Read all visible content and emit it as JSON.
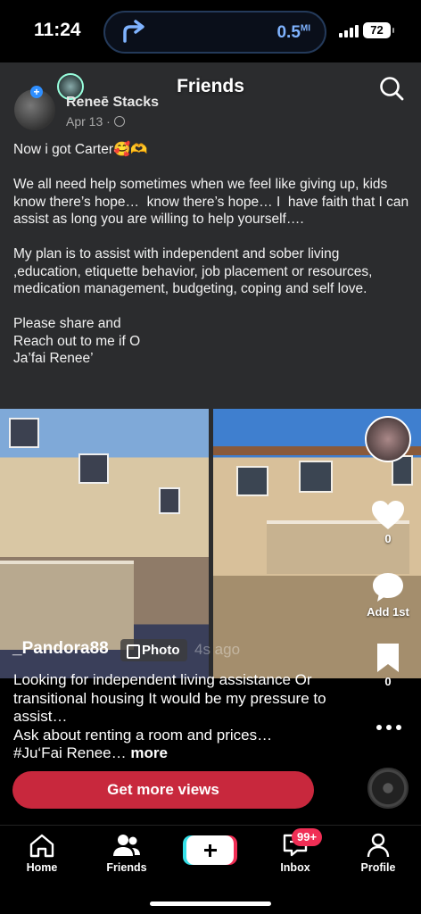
{
  "status_bar": {
    "time": "11:24",
    "navigation_distance": "0.5",
    "navigation_unit": "MI",
    "battery": "72"
  },
  "header": {
    "title": "Friends",
    "search_icon": "search-icon"
  },
  "post": {
    "author": "Reneē Stacks",
    "date": "Apr 13 ·",
    "text": "Now i got Carter🥰🫶\n\nWe all need help sometimes when we feel like giving up, kids know there’s hope…  know there’s hope… I  have faith that I can assist as long you are willing to help yourself….\n\nMy plan is to assist with independent and sober living ,education, etiquette behavior, job placement or resources, medication management, budgeting, coping and self love.\n\nPlease share and\nReach out to me if O\nJa’fai Renee’"
  },
  "actions": {
    "likes": "0",
    "comment_label": "Add 1st",
    "saves": "0"
  },
  "caption": {
    "handle": "_Pandora88",
    "badge": "Photo",
    "time_ago": "4s ago",
    "text": "Looking for independent living assistance Or transitional housing It would be my pressure to assist…\nAsk about renting a room and prices…\n#Ju‘Fai Renee… ",
    "more": "more"
  },
  "cta": {
    "label": "Get more views"
  },
  "tabs": [
    {
      "label": "Home",
      "icon": "home-icon"
    },
    {
      "label": "Friends",
      "icon": "friends-icon"
    },
    {
      "label": "",
      "icon": "create-icon"
    },
    {
      "label": "Inbox",
      "icon": "inbox-icon",
      "badge": "99+"
    },
    {
      "label": "Profile",
      "icon": "profile-icon"
    }
  ],
  "colors": {
    "accent": "#c8283d",
    "badge": "#f02e55",
    "post_background": "#2b2c2e"
  }
}
